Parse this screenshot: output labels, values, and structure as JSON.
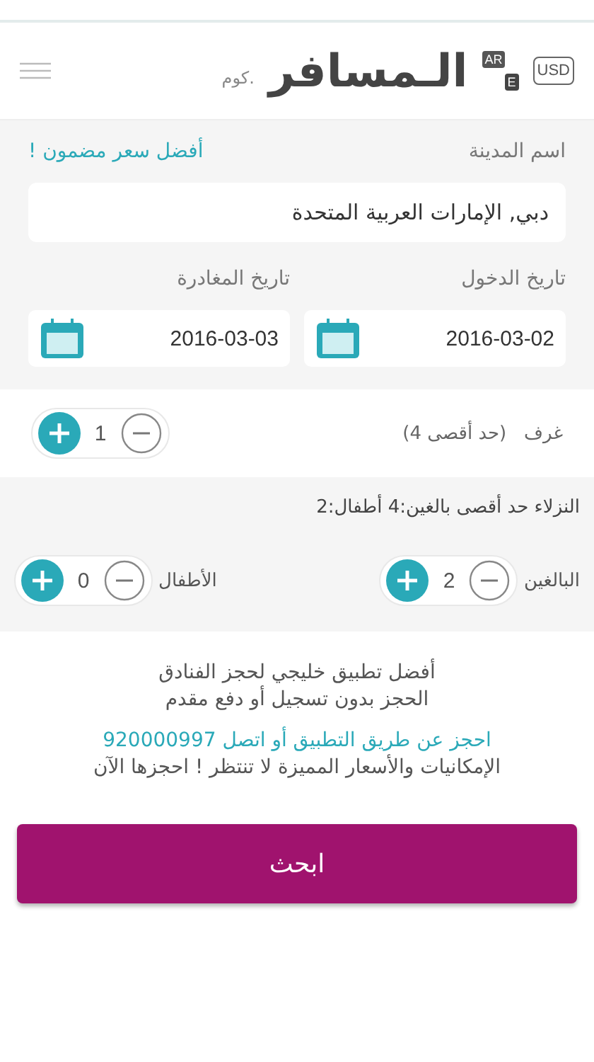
{
  "header": {
    "logo": "الـمسافر",
    "logo_suffix": ".كوم",
    "language": {
      "primary": "AR",
      "secondary": "E"
    },
    "currency": "USD"
  },
  "search": {
    "city_label": "اسم المدينة",
    "promo": "أفضل سعر مضمون !",
    "city_value": "دبي, الإمارات العربية المتحدة",
    "dates": [
      {
        "label": "تاريخ الدخول",
        "value": "2016-03-02"
      },
      {
        "label": "تاريخ المغادرة",
        "value": "2016-03-03"
      }
    ]
  },
  "rooms": {
    "label": "غرف",
    "limit": "(حد أقصى 4)",
    "value": "1"
  },
  "guests": {
    "note": "النزلاء حد أقصى بالغين:4 أطفال:2",
    "counters": [
      {
        "label": "البالغين",
        "value": "2"
      },
      {
        "label": "الأطفال",
        "value": "0"
      }
    ]
  },
  "info": {
    "lines": [
      "أفضل تطبيق خليجي لحجز الفنادق",
      "الحجز بدون تسجيل أو دفع مقدم"
    ],
    "highlight": "احجز عن طريق التطبيق أو اتصل 920000997",
    "footer": "الإمكانيات والأسعار المميزة لا تنتظر ! احجزها الآن"
  },
  "search_button": "ابحث"
}
